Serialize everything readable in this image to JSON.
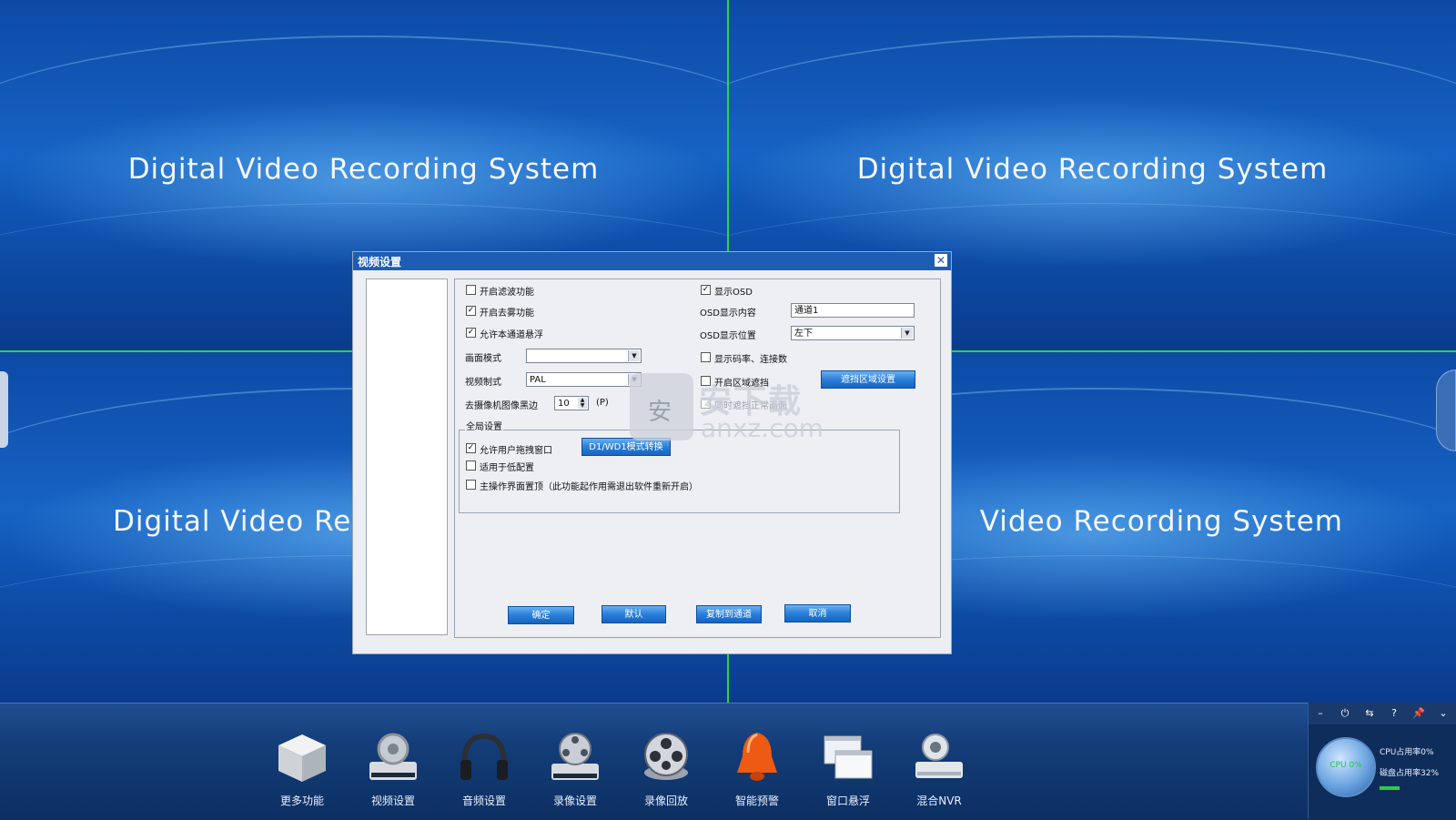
{
  "video_panes": [
    {
      "title": "Digital Video Recording System"
    },
    {
      "title": "Digital Video Recording System"
    },
    {
      "title": "Digital Video Re"
    },
    {
      "title": "Video Recording System"
    }
  ],
  "dialog": {
    "title": "视频设置",
    "close": "✕",
    "left_col": {
      "filter": {
        "label": "开启滤波功能",
        "checked": false
      },
      "defog": {
        "label": "开启去雾功能",
        "checked": true
      },
      "float": {
        "label": "允许本通道悬浮",
        "checked": true
      },
      "screen_mode": {
        "label": "画面模式",
        "value": ""
      },
      "video_format": {
        "label": "视频制式",
        "value": "PAL"
      },
      "black_edge": {
        "label": "去摄像机图像黑边",
        "value": "10",
        "unit": "(P)"
      }
    },
    "right_col": {
      "show_osd": {
        "label": "显示OSD",
        "checked": true
      },
      "osd_content": {
        "label": "OSD显示内容",
        "value": "通道1"
      },
      "osd_position": {
        "label": "OSD显示位置",
        "value": "左下"
      },
      "show_rate": {
        "label": "显示码率、连接数",
        "checked": false
      },
      "region_mask": {
        "label": "开启区域遮挡",
        "checked": false
      },
      "region_button": "遮挡区域设置",
      "mask_hint": "同时遮挡正常画面"
    },
    "global": {
      "title": "全局设置",
      "drag": {
        "label": "允许用户拖拽窗口",
        "checked": true
      },
      "d1_button": "D1/WD1模式转换",
      "low_cfg": {
        "label": "适用于低配置",
        "checked": false
      },
      "topmost": {
        "label": "主操作界面置顶（此功能起作用需退出软件重新开启）",
        "checked": false
      }
    },
    "buttons": {
      "ok": "确定",
      "default": "默认",
      "copy": "复制到通道",
      "cancel": "取消"
    }
  },
  "watermark": {
    "cn": "安下载",
    "en": "anxz.com"
  },
  "taskbar": {
    "items": [
      {
        "label": "更多功能",
        "icon": "box-icon"
      },
      {
        "label": "视频设置",
        "icon": "gear-device-icon"
      },
      {
        "label": "音频设置",
        "icon": "headphones-icon"
      },
      {
        "label": "录像设置",
        "icon": "film-reel-device-icon"
      },
      {
        "label": "录像回放",
        "icon": "film-reel-icon"
      },
      {
        "label": "智能预警",
        "icon": "bell-icon"
      },
      {
        "label": "窗口悬浮",
        "icon": "windows-icon"
      },
      {
        "label": "混合NVR",
        "icon": "camera-nvr-icon"
      }
    ]
  },
  "system": {
    "buttons": [
      "–",
      "⏻",
      "⇆",
      "?",
      "📌",
      "⌄"
    ],
    "gauge_text": "CPU 0%",
    "cpu": "CPU占用率0%",
    "disk": "磁盘占用率32%",
    "disk_fraction": 0.32
  }
}
